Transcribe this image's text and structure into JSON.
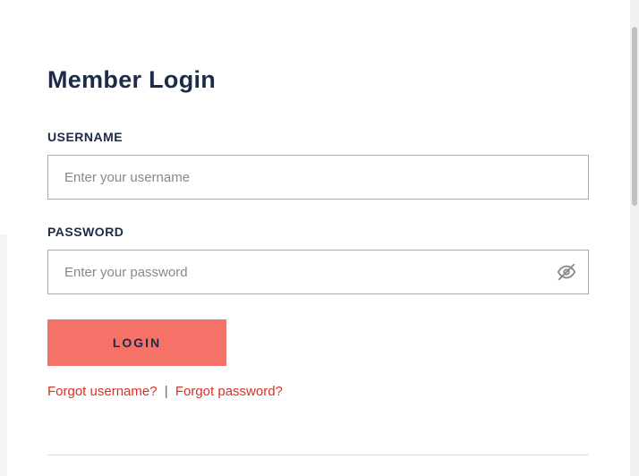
{
  "page": {
    "title": "Member Login"
  },
  "form": {
    "username": {
      "label": "USERNAME",
      "placeholder": "Enter your username",
      "value": ""
    },
    "password": {
      "label": "PASSWORD",
      "placeholder": "Enter your password",
      "value": ""
    },
    "login_button": "LOGIN"
  },
  "links": {
    "forgot_username": "Forgot username?",
    "separator": "|",
    "forgot_password": "Forgot password?"
  }
}
